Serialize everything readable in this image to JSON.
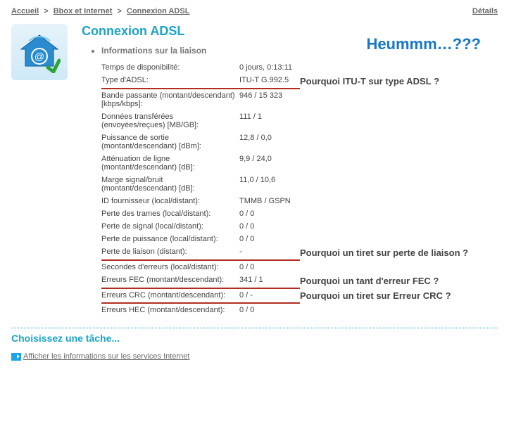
{
  "breadcrumb": {
    "home": "Accueil",
    "sep": ">",
    "node1": "Bbox et Internet",
    "node2": "Connexion ADSL",
    "details": "Détails"
  },
  "page_title": "Connexion ADSL",
  "section_title": "Informations sur la liaison",
  "rows": [
    {
      "label": "Temps de disponibilité:",
      "value": "0 jours, 0:13:11",
      "hl": false,
      "annotation": ""
    },
    {
      "label": "Type d'ADSL:",
      "value": "ITU-T G.992.5",
      "hl": true,
      "annotation": "Pourquoi ITU-T sur type ADSL ?"
    },
    {
      "label": "Bande passante (montant/descendant) [kbps/kbps]:",
      "value": "946 / 15 323",
      "hl": false,
      "annotation": ""
    },
    {
      "label": "Données transférées (envoyées/reçues) [MB/GB]:",
      "value": "111 / 1",
      "hl": false,
      "annotation": ""
    },
    {
      "label": "Puissance de sortie (montant/descendant) [dBm]:",
      "value": "12,8 / 0,0",
      "hl": false,
      "annotation": ""
    },
    {
      "label": "Atténuation de ligne (montant/descendant) [dB]:",
      "value": "9,9 / 24,0",
      "hl": false,
      "annotation": ""
    },
    {
      "label": "Marge signal/bruit (montant/descendant) [dB]:",
      "value": "11,0 / 10,6",
      "hl": false,
      "annotation": ""
    },
    {
      "label": "ID fournisseur (local/distant):",
      "value": "TMMB / GSPN",
      "hl": false,
      "annotation": ""
    },
    {
      "label": "Perte des trames (local/distant):",
      "value": "0 / 0",
      "hl": false,
      "annotation": ""
    },
    {
      "label": "Perte de signal (local/distant):",
      "value": "0 / 0",
      "hl": false,
      "annotation": ""
    },
    {
      "label": "Perte de puissance (local/distant):",
      "value": "0 / 0",
      "hl": false,
      "annotation": ""
    },
    {
      "label": "Perte de liaison (distant):",
      "value": "-",
      "hl": true,
      "annotation": "Pourquoi un tiret sur perte de liaison ?"
    },
    {
      "label": "Secondes d'erreurs (local/distant):",
      "value": "0 / 0",
      "hl": false,
      "annotation": ""
    },
    {
      "label": "Erreurs FEC (montant/descendant):",
      "value": "341 / 1",
      "hl": true,
      "annotation": "Pourquoi un tant d'erreur FEC ?"
    },
    {
      "label": "Erreurs CRC (montant/descendant):",
      "value": "0 / -",
      "hl": true,
      "annotation": "Pourquoi un tiret sur Erreur CRC ?"
    },
    {
      "label": "Erreurs HEC (montant/descendant):",
      "value": "0 / 0",
      "hl": false,
      "annotation": ""
    }
  ],
  "heummm": "Heummm…???",
  "task_title": "Choisissez une tâche...",
  "task_link": "Afficher les informations sur les services Internet"
}
